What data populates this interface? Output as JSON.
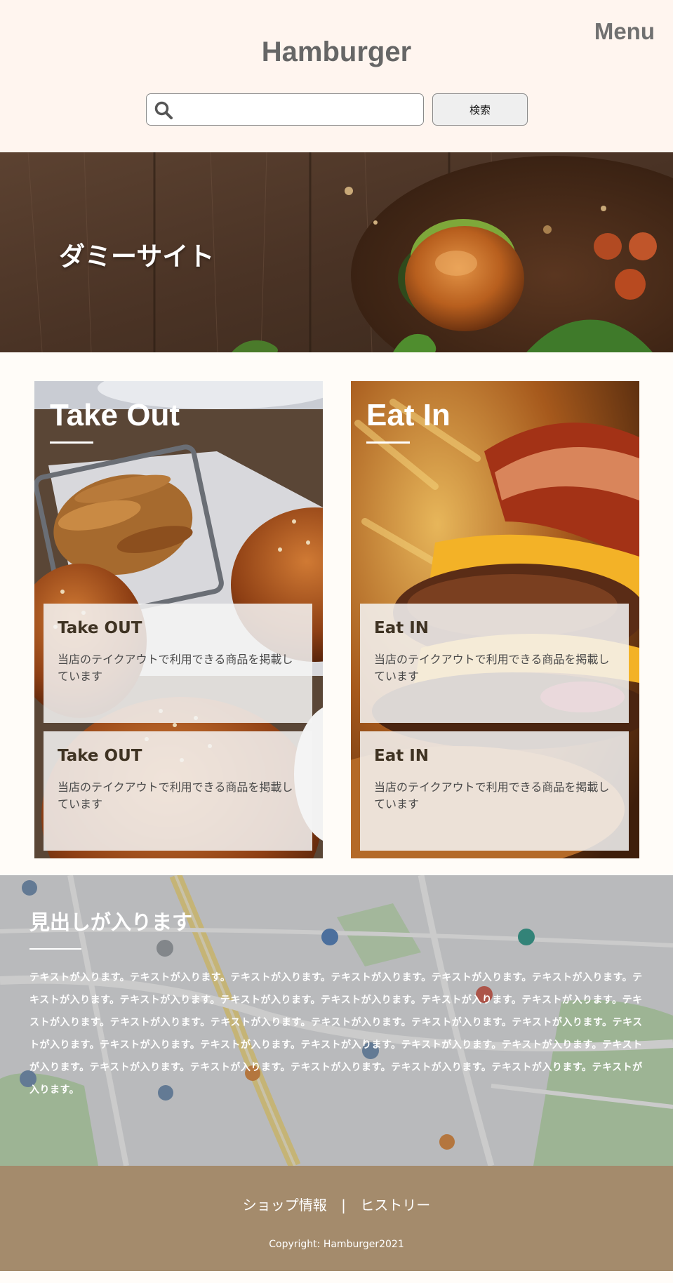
{
  "header": {
    "title": "Hamburger",
    "menu_label": "Menu",
    "search": {
      "placeholder": "",
      "value": "",
      "button_label": "検索"
    }
  },
  "hero": {
    "title": "ダミーサイト"
  },
  "sections": [
    {
      "title": "Take Out",
      "cards": [
        {
          "title": "Take OUT",
          "text": "当店のテイクアウトで利用できる商品を掲載しています"
        },
        {
          "title": "Take OUT",
          "text": "当店のテイクアウトで利用できる商品を掲載しています"
        }
      ]
    },
    {
      "title": "Eat In",
      "cards": [
        {
          "title": "Eat IN",
          "text": "当店のテイクアウトで利用できる商品を掲載しています"
        },
        {
          "title": "Eat IN",
          "text": "当店のテイクアウトで利用できる商品を掲載しています"
        }
      ]
    }
  ],
  "map_section": {
    "heading": "見出しが入ります",
    "body": "テキストが入ります。テキストが入ります。テキストが入ります。テキストが入ります。テキストが入ります。テキストが入ります。テキストが入ります。テキストが入ります。テキストが入ります。テキストが入ります。テキストが入ります。テキストが入ります。テキストが入ります。テキストが入ります。テキストが入ります。テキストが入ります。テキストが入ります。テキストが入ります。テキストが入ります。テキストが入ります。テキストが入ります。テキストが入ります。テキストが入ります。テキストが入ります。テキストが入ります。テキストが入ります。テキストが入ります。テキストが入ります。テキストが入ります。テキストが入ります。テキストが入ります。"
  },
  "footer": {
    "nav": [
      "ショップ情報",
      "ヒストリー"
    ],
    "separator": "|",
    "copyright": "Copyright: Hamburger2021"
  },
  "colors": {
    "header_bg": "#fff5ef",
    "footer_bg": "#a48b6c",
    "title_gray": "#666666",
    "card_title_brown": "#3f3323"
  },
  "icons": {
    "search": "search-icon"
  }
}
